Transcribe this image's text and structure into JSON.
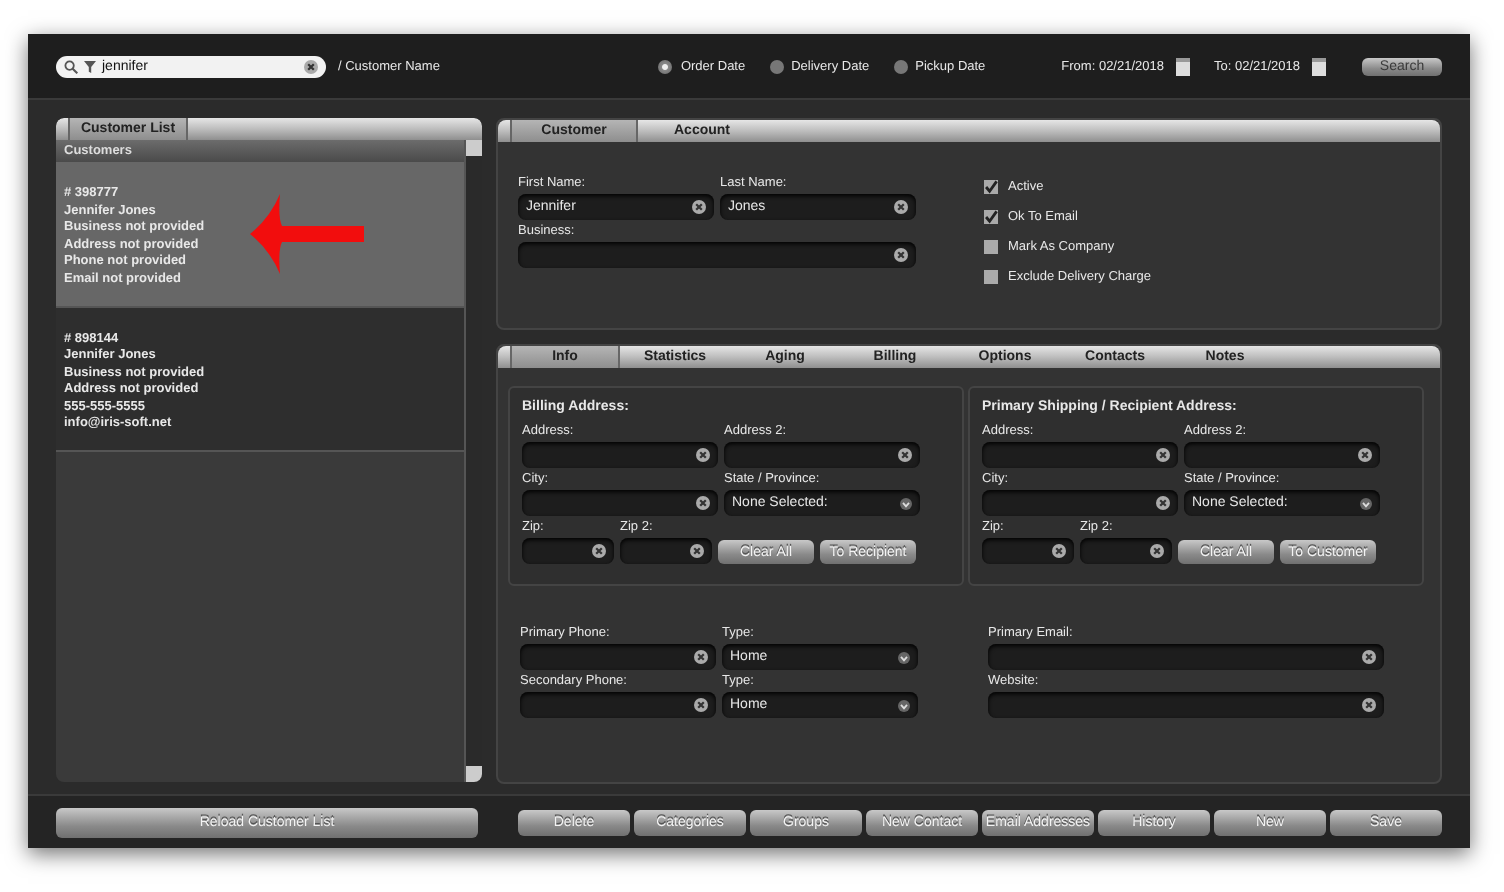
{
  "search": {
    "value": "jennifer",
    "scope": "/ Customer Name"
  },
  "date_options": [
    {
      "label": "Order Date",
      "selected": true
    },
    {
      "label": "Delivery Date",
      "selected": false
    },
    {
      "label": "Pickup Date",
      "selected": false
    }
  ],
  "date_range": [
    {
      "label": "From: 02/21/2018"
    },
    {
      "label": "To: 02/21/2018"
    }
  ],
  "search_button": "Search",
  "customer_list": {
    "tab": "Customer List",
    "header": "Customers",
    "customers": [
      {
        "selected": true,
        "lines": [
          "# 398777",
          "Jennifer Jones",
          "Business not provided",
          "Address not provided",
          "Phone not provided",
          "Email not provided"
        ]
      },
      {
        "selected": false,
        "lines": [
          "# 898144",
          "Jennifer Jones",
          "Business not provided",
          "Address not provided",
          "555-555-5555",
          "info@iris-soft.net"
        ]
      }
    ]
  },
  "reload_button": "Reload Customer List",
  "customer_tabs": [
    {
      "label": "Customer",
      "selected": true
    },
    {
      "label": "Account",
      "selected": false
    }
  ],
  "name_fields": [
    {
      "label": "First Name:",
      "value": "Jennifer"
    },
    {
      "label": "Last Name:",
      "value": "Jones"
    },
    {
      "label": "Business:"
    }
  ],
  "flags": [
    {
      "label": "Active",
      "checked": true
    },
    {
      "label": "Ok To Email",
      "checked": true
    },
    {
      "label": "Mark As Company",
      "checked": false
    },
    {
      "label": "Exclude Delivery Charge",
      "checked": false
    }
  ],
  "info_tabs": [
    {
      "label": "Info",
      "selected": true
    },
    {
      "label": "Statistics",
      "selected": false
    },
    {
      "label": "Aging",
      "selected": false
    },
    {
      "label": "Billing",
      "selected": false
    },
    {
      "label": "Options",
      "selected": false
    },
    {
      "label": "Contacts",
      "selected": false
    },
    {
      "label": "Notes",
      "selected": false
    }
  ],
  "address_sections": [
    {
      "title": "Billing Address:",
      "fields": [
        {
          "kind": "text",
          "label": "Address:"
        },
        {
          "kind": "text",
          "label": "Address 2:"
        },
        {
          "kind": "text",
          "label": "City:"
        },
        {
          "kind": "select",
          "label": "State / Province:",
          "value": "None Selected:"
        },
        {
          "kind": "short",
          "label": "Zip:"
        },
        {
          "kind": "short",
          "label": "Zip 2:"
        }
      ],
      "buttons": [
        "Clear All",
        "To Recipient"
      ]
    },
    {
      "title": "Primary Shipping / Recipient Address:",
      "fields": [
        {
          "kind": "text",
          "label": "Address:"
        },
        {
          "kind": "text",
          "label": "Address 2:"
        },
        {
          "kind": "text",
          "label": "City:"
        },
        {
          "kind": "select",
          "label": "State / Province:",
          "value": "None Selected:"
        },
        {
          "kind": "short",
          "label": "Zip:"
        },
        {
          "kind": "short",
          "label": "Zip 2:"
        }
      ],
      "buttons": [
        "Clear All",
        "To Customer"
      ]
    }
  ],
  "contact_fields": [
    {
      "kind": "text",
      "label": "Primary Phone:"
    },
    {
      "kind": "select",
      "label": "Type:",
      "value": "Home"
    },
    {
      "kind": "wide",
      "label": "Primary Email:"
    },
    {
      "kind": "text",
      "label": "Secondary Phone:"
    },
    {
      "kind": "select",
      "label": "Type:",
      "value": "Home"
    },
    {
      "kind": "wide",
      "label": "Website:"
    }
  ],
  "actions": [
    "Delete",
    "Categories",
    "Groups",
    "New Contact",
    "Email Addresses",
    "History",
    "New",
    "Save"
  ]
}
